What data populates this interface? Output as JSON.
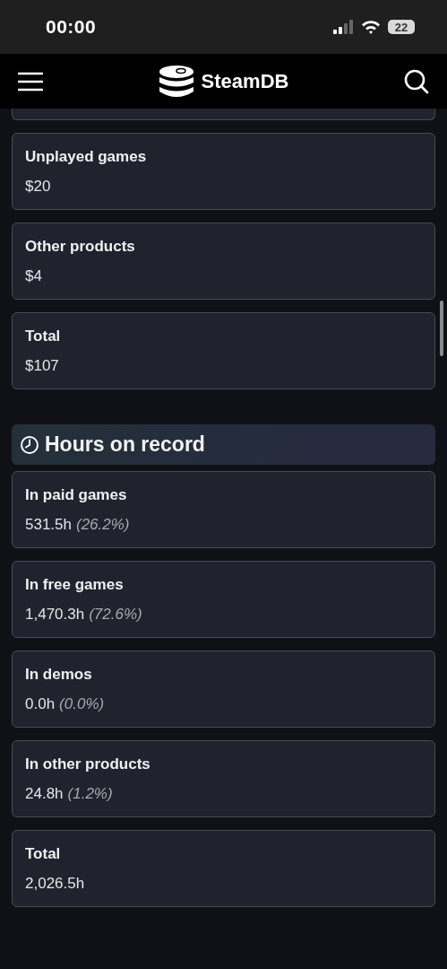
{
  "status_bar": {
    "time": "00:00",
    "battery": "22"
  },
  "header": {
    "title": "SteamDB"
  },
  "value_cards": [
    {
      "label": "Unplayed games",
      "value": "$20"
    },
    {
      "label": "Other products",
      "value": "$4"
    },
    {
      "label": "Total",
      "value": "$107"
    }
  ],
  "hours_section": {
    "title": "Hours on record",
    "cards": [
      {
        "label": "In paid games",
        "value": "531.5h",
        "percent": "(26.2%)"
      },
      {
        "label": "In free games",
        "value": "1,470.3h",
        "percent": "(72.6%)"
      },
      {
        "label": "In demos",
        "value": "0.0h",
        "percent": "(0.0%)"
      },
      {
        "label": "In other products",
        "value": "24.8h",
        "percent": "(1.2%)"
      },
      {
        "label": "Total",
        "value": "2,026.5h"
      }
    ]
  }
}
